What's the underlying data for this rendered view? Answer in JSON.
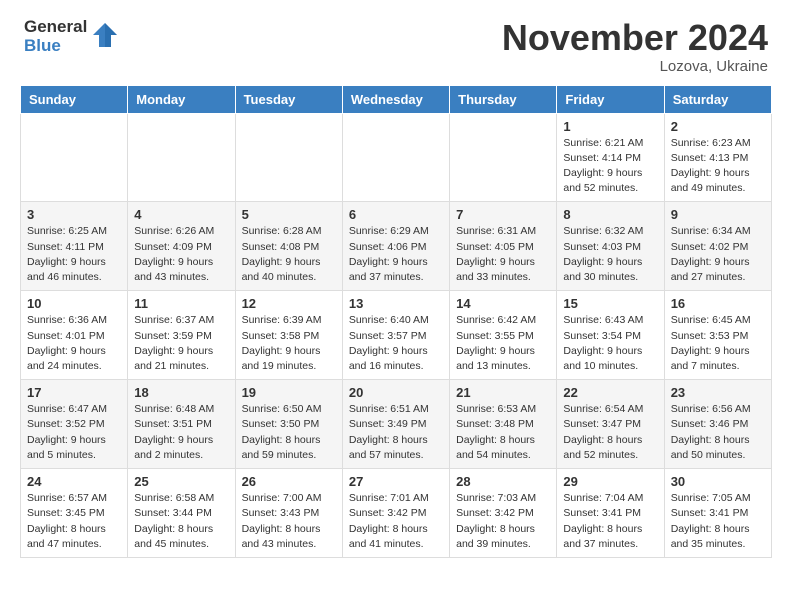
{
  "header": {
    "logo_general": "General",
    "logo_blue": "Blue",
    "month_title": "November 2024",
    "location": "Lozova, Ukraine"
  },
  "weekdays": [
    "Sunday",
    "Monday",
    "Tuesday",
    "Wednesday",
    "Thursday",
    "Friday",
    "Saturday"
  ],
  "weeks": [
    [
      {
        "day": "",
        "info": ""
      },
      {
        "day": "",
        "info": ""
      },
      {
        "day": "",
        "info": ""
      },
      {
        "day": "",
        "info": ""
      },
      {
        "day": "",
        "info": ""
      },
      {
        "day": "1",
        "info": "Sunrise: 6:21 AM\nSunset: 4:14 PM\nDaylight: 9 hours\nand 52 minutes."
      },
      {
        "day": "2",
        "info": "Sunrise: 6:23 AM\nSunset: 4:13 PM\nDaylight: 9 hours\nand 49 minutes."
      }
    ],
    [
      {
        "day": "3",
        "info": "Sunrise: 6:25 AM\nSunset: 4:11 PM\nDaylight: 9 hours\nand 46 minutes."
      },
      {
        "day": "4",
        "info": "Sunrise: 6:26 AM\nSunset: 4:09 PM\nDaylight: 9 hours\nand 43 minutes."
      },
      {
        "day": "5",
        "info": "Sunrise: 6:28 AM\nSunset: 4:08 PM\nDaylight: 9 hours\nand 40 minutes."
      },
      {
        "day": "6",
        "info": "Sunrise: 6:29 AM\nSunset: 4:06 PM\nDaylight: 9 hours\nand 37 minutes."
      },
      {
        "day": "7",
        "info": "Sunrise: 6:31 AM\nSunset: 4:05 PM\nDaylight: 9 hours\nand 33 minutes."
      },
      {
        "day": "8",
        "info": "Sunrise: 6:32 AM\nSunset: 4:03 PM\nDaylight: 9 hours\nand 30 minutes."
      },
      {
        "day": "9",
        "info": "Sunrise: 6:34 AM\nSunset: 4:02 PM\nDaylight: 9 hours\nand 27 minutes."
      }
    ],
    [
      {
        "day": "10",
        "info": "Sunrise: 6:36 AM\nSunset: 4:01 PM\nDaylight: 9 hours\nand 24 minutes."
      },
      {
        "day": "11",
        "info": "Sunrise: 6:37 AM\nSunset: 3:59 PM\nDaylight: 9 hours\nand 21 minutes."
      },
      {
        "day": "12",
        "info": "Sunrise: 6:39 AM\nSunset: 3:58 PM\nDaylight: 9 hours\nand 19 minutes."
      },
      {
        "day": "13",
        "info": "Sunrise: 6:40 AM\nSunset: 3:57 PM\nDaylight: 9 hours\nand 16 minutes."
      },
      {
        "day": "14",
        "info": "Sunrise: 6:42 AM\nSunset: 3:55 PM\nDaylight: 9 hours\nand 13 minutes."
      },
      {
        "day": "15",
        "info": "Sunrise: 6:43 AM\nSunset: 3:54 PM\nDaylight: 9 hours\nand 10 minutes."
      },
      {
        "day": "16",
        "info": "Sunrise: 6:45 AM\nSunset: 3:53 PM\nDaylight: 9 hours\nand 7 minutes."
      }
    ],
    [
      {
        "day": "17",
        "info": "Sunrise: 6:47 AM\nSunset: 3:52 PM\nDaylight: 9 hours\nand 5 minutes."
      },
      {
        "day": "18",
        "info": "Sunrise: 6:48 AM\nSunset: 3:51 PM\nDaylight: 9 hours\nand 2 minutes."
      },
      {
        "day": "19",
        "info": "Sunrise: 6:50 AM\nSunset: 3:50 PM\nDaylight: 8 hours\nand 59 minutes."
      },
      {
        "day": "20",
        "info": "Sunrise: 6:51 AM\nSunset: 3:49 PM\nDaylight: 8 hours\nand 57 minutes."
      },
      {
        "day": "21",
        "info": "Sunrise: 6:53 AM\nSunset: 3:48 PM\nDaylight: 8 hours\nand 54 minutes."
      },
      {
        "day": "22",
        "info": "Sunrise: 6:54 AM\nSunset: 3:47 PM\nDaylight: 8 hours\nand 52 minutes."
      },
      {
        "day": "23",
        "info": "Sunrise: 6:56 AM\nSunset: 3:46 PM\nDaylight: 8 hours\nand 50 minutes."
      }
    ],
    [
      {
        "day": "24",
        "info": "Sunrise: 6:57 AM\nSunset: 3:45 PM\nDaylight: 8 hours\nand 47 minutes."
      },
      {
        "day": "25",
        "info": "Sunrise: 6:58 AM\nSunset: 3:44 PM\nDaylight: 8 hours\nand 45 minutes."
      },
      {
        "day": "26",
        "info": "Sunrise: 7:00 AM\nSunset: 3:43 PM\nDaylight: 8 hours\nand 43 minutes."
      },
      {
        "day": "27",
        "info": "Sunrise: 7:01 AM\nSunset: 3:42 PM\nDaylight: 8 hours\nand 41 minutes."
      },
      {
        "day": "28",
        "info": "Sunrise: 7:03 AM\nSunset: 3:42 PM\nDaylight: 8 hours\nand 39 minutes."
      },
      {
        "day": "29",
        "info": "Sunrise: 7:04 AM\nSunset: 3:41 PM\nDaylight: 8 hours\nand 37 minutes."
      },
      {
        "day": "30",
        "info": "Sunrise: 7:05 AM\nSunset: 3:41 PM\nDaylight: 8 hours\nand 35 minutes."
      }
    ]
  ]
}
